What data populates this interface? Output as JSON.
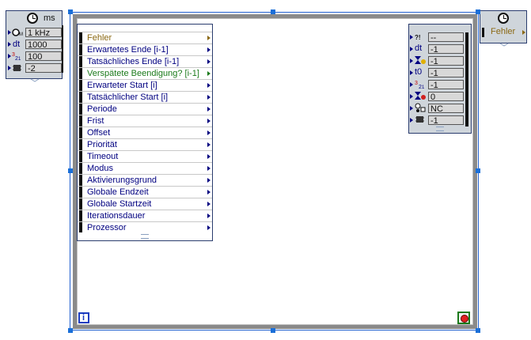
{
  "timing_source_node": {
    "unit_label": "ms",
    "rows": [
      {
        "icon": "clock-source-icon",
        "value": "1 kHz"
      },
      {
        "icon": "dt-label",
        "label": "dt",
        "value": "1000"
      },
      {
        "icon": "priority-icon",
        "value": "100"
      },
      {
        "icon": "processor-icon",
        "value": "-2"
      }
    ]
  },
  "error_in_node": {
    "label": "Fehler"
  },
  "left_node_items": [
    "Fehler",
    "Erwartetes Ende [i-1]",
    "Tatsächliches Ende [i-1]",
    "Verspätete Beendigung? [i-1]",
    "Erwarteter Start [i]",
    "Tatsächlicher Start [i]",
    "Periode",
    "Frist",
    "Offset",
    "Priorität",
    "Timeout",
    "Modus",
    "Aktivierungsgrund",
    "Globale Endzeit",
    "Globale Startzeit",
    "Iterationsdauer",
    "Prozessor"
  ],
  "right_node_rows": [
    {
      "icon": "error-warning-icon",
      "value": "--"
    },
    {
      "icon": "dt-label",
      "label": "dt",
      "value": "-1"
    },
    {
      "icon": "hourglass-warning-icon",
      "value": "-1"
    },
    {
      "icon": "t0-label",
      "label": "t0",
      "value": "-1"
    },
    {
      "icon": "priority-icon",
      "value": "-1"
    },
    {
      "icon": "hourglass-error-icon",
      "value": "0"
    },
    {
      "icon": "mode-icon",
      "value": "NC"
    },
    {
      "icon": "processor-icon",
      "value": "-1"
    }
  ],
  "loop": {
    "iteration_label": "i"
  },
  "colors": {
    "wire_blue": "#000080",
    "error_olive": "#8b6914",
    "bool_green": "#1a7a1a",
    "frame_gray": "#8a8a8a",
    "handle_blue": "#1a6fd8",
    "stop_red": "#e02020"
  }
}
